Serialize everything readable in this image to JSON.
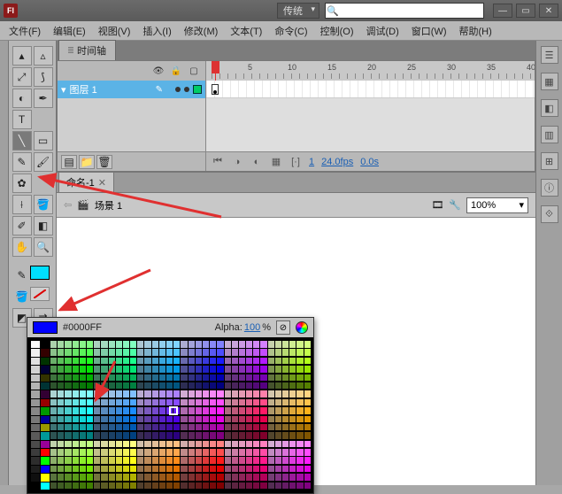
{
  "titlebar": {
    "logo_letter": "Fl",
    "layout_label": "传统",
    "search_value": ""
  },
  "menus": [
    "文件(F)",
    "编辑(E)",
    "视图(V)",
    "插入(I)",
    "修改(M)",
    "文本(T)",
    "命令(C)",
    "控制(O)",
    "调试(D)",
    "窗口(W)",
    "帮助(H)"
  ],
  "timeline": {
    "tab_label": "时间轴",
    "ruler_marks": [
      "5",
      "10",
      "15",
      "20",
      "25",
      "30",
      "35",
      "40"
    ],
    "layer_name": "图层 1",
    "current_frame": "1",
    "fps": "24.0fps",
    "elapsed": "0.0s"
  },
  "document": {
    "tab_name": "命名-1",
    "scene_label": "场景 1",
    "zoom": "100%"
  },
  "color_popup": {
    "hex": "#0000FF",
    "alpha_label": "Alpha:",
    "alpha_value": "100",
    "alpha_pct": "%"
  }
}
